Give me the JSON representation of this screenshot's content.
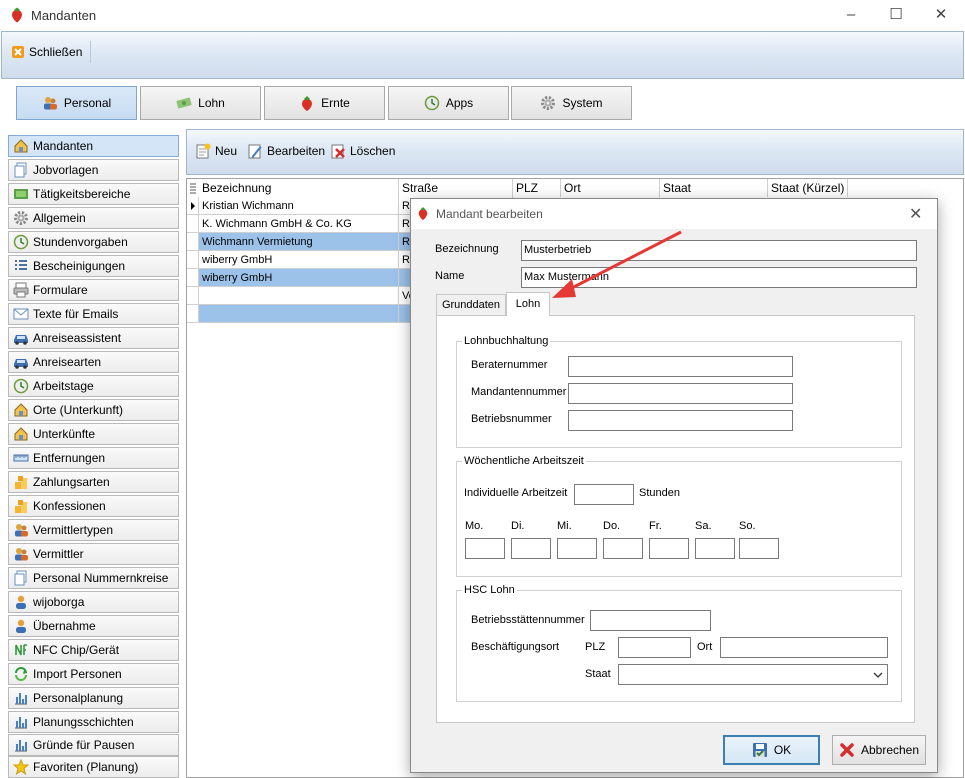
{
  "window": {
    "title": "Mandanten",
    "controls": [
      "–",
      "☐",
      "✕"
    ]
  },
  "ribbon": {
    "close_label": "Schließen"
  },
  "modules": [
    {
      "label": "Personal",
      "icon": "people-icon",
      "active": true
    },
    {
      "label": "Lohn",
      "icon": "money-icon",
      "active": false
    },
    {
      "label": "Ernte",
      "icon": "strawberry-icon",
      "active": false
    },
    {
      "label": "Apps",
      "icon": "apps-icon",
      "active": false
    },
    {
      "label": "System",
      "icon": "gear-icon",
      "active": false
    }
  ],
  "sidebar": {
    "items": [
      {
        "label": "Mandanten",
        "icon": "house-icon",
        "active": true
      },
      {
        "label": "Jobvorlagen",
        "icon": "copy-icon"
      },
      {
        "label": "Tätigkeitsbereiche",
        "icon": "area-icon"
      },
      {
        "label": "Allgemein",
        "icon": "gear-icon"
      },
      {
        "label": "Stundenvorgaben",
        "icon": "clock-icon"
      },
      {
        "label": "Bescheinigungen",
        "icon": "list-icon"
      },
      {
        "label": "Formulare",
        "icon": "printer-icon"
      },
      {
        "label": "Texte für Emails",
        "icon": "mail-icon"
      },
      {
        "label": "Anreiseassistent",
        "icon": "car-icon"
      },
      {
        "label": "Anreisearten",
        "icon": "car-icon"
      },
      {
        "label": "Arbeitstage",
        "icon": "clock-icon"
      },
      {
        "label": "Orte (Unterkunft)",
        "icon": "house-icon"
      },
      {
        "label": "Unterkünfte",
        "icon": "house-icon"
      },
      {
        "label": "Entfernungen",
        "icon": "ruler-icon"
      },
      {
        "label": "Zahlungsarten",
        "icon": "coins-icon"
      },
      {
        "label": "Konfessionen",
        "icon": "coins-icon"
      },
      {
        "label": "Vermittlertypen",
        "icon": "people-icon"
      },
      {
        "label": "Vermittler",
        "icon": "people-icon"
      },
      {
        "label": "Personal Nummernkreise",
        "icon": "copy-icon"
      },
      {
        "label": "wijoborga",
        "icon": "person-icon"
      },
      {
        "label": "Übernahme",
        "icon": "person-icon"
      },
      {
        "label": "NFC Chip/Gerät",
        "icon": "nfc-icon"
      },
      {
        "label": "Import Personen",
        "icon": "import-icon"
      },
      {
        "label": "Personalplanung",
        "icon": "chart-icon"
      },
      {
        "label": "Planungsschichten",
        "icon": "chart-icon"
      },
      {
        "label": "Gründe für Pausen",
        "icon": "chart-icon"
      },
      {
        "label": "Favoriten (Planung)",
        "icon": "star-icon"
      }
    ]
  },
  "content_toolbar": {
    "new_label": "Neu",
    "edit_label": "Bearbeiten",
    "delete_label": "Löschen"
  },
  "grid": {
    "columns": [
      "Bezeichnung",
      "Straße",
      "PLZ",
      "Ort",
      "Staat",
      "Staat (Kürzel)"
    ],
    "rows": [
      {
        "cells": [
          "Kristian Wichmann",
          "Rö"
        ],
        "selected": false,
        "current": true
      },
      {
        "cells": [
          "K. Wichmann GmbH & Co. KG",
          "Rö"
        ],
        "selected": false,
        "current": false
      },
      {
        "cells": [
          "Wichmann Vermietung",
          "Rö"
        ],
        "selected": true,
        "current": false
      },
      {
        "cells": [
          "wiberry GmbH",
          "Rö"
        ],
        "selected": false,
        "current": false
      },
      {
        "cells": [
          "wiberry GmbH",
          ""
        ],
        "selected": true,
        "current": false
      },
      {
        "cells": [
          "",
          "Vo"
        ],
        "selected": false,
        "current": false
      },
      {
        "cells": [
          "",
          ""
        ],
        "selected": true,
        "current": false
      }
    ]
  },
  "dialog": {
    "title": "Mandant bearbeiten",
    "bezeichnung_label": "Bezeichnung",
    "bezeichnung_value": "Musterbetrieb",
    "name_label": "Name",
    "name_value": "Max Mustermann",
    "tabs": [
      {
        "label": "Grunddaten",
        "active": false
      },
      {
        "label": "Lohn",
        "active": true
      }
    ],
    "lohnbuchhaltung": {
      "title": "Lohnbuchhaltung",
      "berater_label": "Beraternummer",
      "mandanten_label": "Mandantennummer",
      "betriebs_label": "Betriebsnummer"
    },
    "arbeitszeit": {
      "title": "Wöchentliche Arbeitszeit",
      "individual_label": "Individuelle Arbeitzeit",
      "unit_label": "Stunden",
      "days": [
        "Mo.",
        "Di.",
        "Mi.",
        "Do.",
        "Fr.",
        "Sa.",
        "So."
      ]
    },
    "hsc": {
      "title": "HSC Lohn",
      "betriebsstaetten_label": "Betriebsstättennummer",
      "beschaeftigungsort_label": "Beschäftigungsort",
      "plz_label": "PLZ",
      "ort_label": "Ort",
      "staat_label": "Staat"
    },
    "ok_label": "OK",
    "cancel_label": "Abbrechen"
  },
  "colors": {
    "accent": "#3b82c4",
    "selected_row": "#9cc2ea",
    "arrow": "#e53935"
  }
}
